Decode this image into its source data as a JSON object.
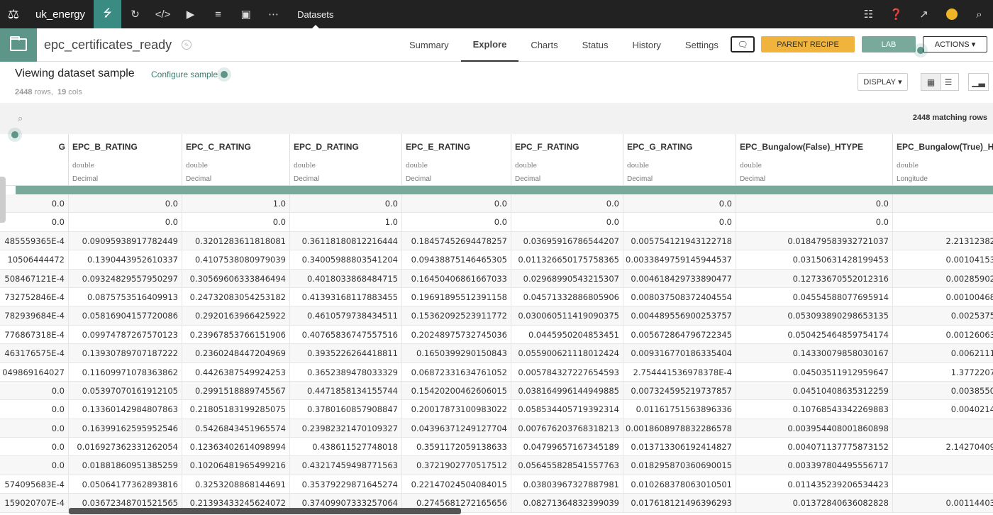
{
  "topnav": {
    "project": "uk_energy",
    "crumb": "Datasets",
    "icons": [
      "flow-icon",
      "jobs-icon",
      "code-icon",
      "run-icon",
      "library-icon",
      "dashboard-icon",
      "more-icon"
    ],
    "right_icons": [
      "apps-icon",
      "help-icon",
      "trend-icon",
      "notifications-icon",
      "search-icon"
    ]
  },
  "header": {
    "dataset_name": "epc_certificates_ready",
    "tabs": [
      "Summary",
      "Explore",
      "Charts",
      "Status",
      "History",
      "Settings"
    ],
    "active_tab": "Explore",
    "parent_recipe": "PARENT RECIPE",
    "lab": "LAB",
    "actions": "ACTIONS"
  },
  "sample": {
    "title": "Viewing dataset sample",
    "configure": "Configure sample",
    "rows": "2448",
    "rows_suffix": "rows,",
    "cols": "19",
    "cols_suffix": "cols",
    "display": "DISPLAY",
    "matching": "2448 matching rows"
  },
  "accent": "#79a99b",
  "columns": [
    {
      "name": "G",
      "type": "",
      "meaning": ""
    },
    {
      "name": "EPC_B_RATING",
      "type": "double",
      "meaning": "Decimal"
    },
    {
      "name": "EPC_C_RATING",
      "type": "double",
      "meaning": "Decimal"
    },
    {
      "name": "EPC_D_RATING",
      "type": "double",
      "meaning": "Decimal"
    },
    {
      "name": "EPC_E_RATING",
      "type": "double",
      "meaning": "Decimal"
    },
    {
      "name": "EPC_F_RATING",
      "type": "double",
      "meaning": "Decimal"
    },
    {
      "name": "EPC_G_RATING",
      "type": "double",
      "meaning": "Decimal"
    },
    {
      "name": "EPC_Bungalow(False)_HTYPE",
      "type": "double",
      "meaning": "Decimal"
    },
    {
      "name": "EPC_Bungalow(True)_HT",
      "type": "double",
      "meaning": "Longitude"
    }
  ],
  "rows": [
    [
      "0.0",
      "0.0",
      "1.0",
      "0.0",
      "0.0",
      "0.0",
      "0.0",
      "0.0",
      ""
    ],
    [
      "0.0",
      "0.0",
      "0.0",
      "1.0",
      "0.0",
      "0.0",
      "0.0",
      "0.0",
      ""
    ],
    [
      "485559365E-4",
      "0.09095938917782449",
      "0.3201283611818081",
      "0.36118180812216444",
      "0.18457452694478257",
      "0.03695916786544207",
      "0.005754121943122718",
      "0.018479583932721037",
      "2.21312382"
    ],
    [
      "10506444472",
      "0.1390443952610337",
      "0.4107538080979039",
      "0.34005988803541204",
      "0.09438875146465305",
      "0.011326650175758365",
      "0.0033849759145944537",
      "0.03150631428199453",
      "0.00104153"
    ],
    [
      "508467121E-4",
      "0.09324829557950297",
      "0.30569606333846494",
      "0.4018033868484715",
      "0.16450406861667033",
      "0.02968990543215307",
      "0.004618429733890477",
      "0.12733670552012316",
      "0.00285902"
    ],
    [
      "732752846E-4",
      "0.0875753516409913",
      "0.24732083054253182",
      "0.41393168117883455",
      "0.19691895512391158",
      "0.04571332886805906",
      "0.008037508372404554",
      "0.04554588077695914",
      "0.00100468"
    ],
    [
      "782939684E-4",
      "0.05816904157720086",
      "0.2920163966425922",
      "0.4610579738434511",
      "0.15362092523911772",
      "0.030060511419090375",
      "0.004489556900253757",
      "0.053093890298653135",
      "0.0025375"
    ],
    [
      "776867318E-4",
      "0.09974787267570123",
      "0.23967853766151906",
      "0.40765836747557516",
      "0.20248975732745036",
      "0.044595020485345 1",
      "0.005672864796722345",
      "0.050425464859754174",
      "0.00126063"
    ],
    [
      "463176575E-4",
      "0.13930789707187222",
      "0.2360248447204969",
      "0.3935226264418811",
      "0.1650399290150843",
      "0.055900621118012424",
      "0.009316770186335404",
      "0.14330079858030167",
      "0.0062111"
    ],
    [
      "049869164027",
      "0.11609971078363862",
      "0.4426387549924253",
      "0.3652389478033329",
      "0.06872331634761052",
      "0.005784327227654593",
      "2.754441536978378E-4",
      "0.04503511912959647",
      "1.3772207"
    ],
    [
      "0.0",
      "0.05397070161912105",
      "0.2991518889745567",
      "0.4471858134155744",
      "0.15420200462606015",
      "0.038164996144949885",
      "0.007324595219737857",
      "0.04510408635312259",
      "0.0038550"
    ],
    [
      "0.0",
      "0.13360142984807863",
      "0.21805183199285075",
      "0.3780160857908847",
      "0.20017873100983022",
      "0.058534405719392314",
      "0.01161751563896336",
      "0.10768543342269883",
      "0.0040214"
    ],
    [
      "0.0",
      "0.16399162595952546",
      "0.5426843451965574",
      "0.23982321470109327",
      "0.04396371249127704",
      "0.007676203768318213",
      "0.0018608978832286578",
      "0.003954408001860898",
      ""
    ],
    [
      "0.0",
      "0.016927362331262054",
      "0.12363402614098994",
      "0.438611527748018",
      "0.3591172059138633",
      "0.04799657167345189",
      "0.013713306192414827",
      "0.004071137775873152",
      "2.14270409"
    ],
    [
      "0.0",
      "0.01881860951385259",
      "0.10206481965499216",
      "0.4321745949877156 3",
      "0.3721902770517512",
      "0.056455828541557763",
      "0.018295870360690015",
      "0.003397804495556717",
      ""
    ],
    [
      "574095683E-4",
      "0.050641773628938 16",
      "0.3253208868144691",
      "0.3537922987164527 4",
      "0.2214702450408401 5",
      "0.03803967327887981",
      "0.010268378063010501",
      "0.011435239206534423",
      ""
    ],
    [
      "159020707E-4",
      "0.03672348701521565",
      "0.21393433245624072",
      "0.3740990733325706 4",
      "0.2745681272165656",
      "0.08271364832399039",
      "0.017618121496396293",
      "0.01372840636082828",
      "0.00114403"
    ]
  ]
}
